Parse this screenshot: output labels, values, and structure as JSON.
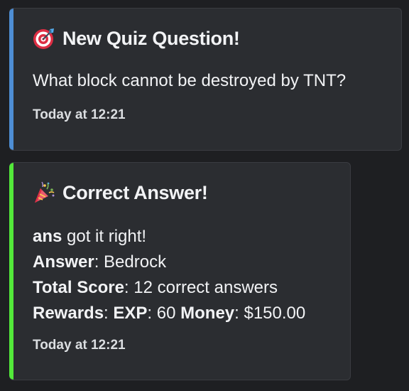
{
  "colors": {
    "background": "#1e1f22",
    "embed_bg": "#2b2d31",
    "quiz_accent": "#4e8ed4",
    "answer_accent": "#53e93a"
  },
  "quiz_embed": {
    "icon": "direct-hit-target-icon",
    "title": "New Quiz Question!",
    "question": "What block cannot be destroyed by TNT?",
    "timestamp": "Today at 12:21"
  },
  "answer_embed": {
    "icon": "party-popper-icon",
    "title": "Correct Answer!",
    "user": "ans",
    "user_suffix": " got it right!",
    "answer_label": "Answer",
    "answer_value": ": Bedrock",
    "score_label": "Total Score",
    "score_value": ": 12 correct answers",
    "rewards_label": "Rewards",
    "rewards_sep": ": ",
    "exp_label": "EXP",
    "exp_value": ": 60 ",
    "money_label": "Money",
    "money_value": ": $150.00",
    "timestamp": "Today at 12:21"
  }
}
